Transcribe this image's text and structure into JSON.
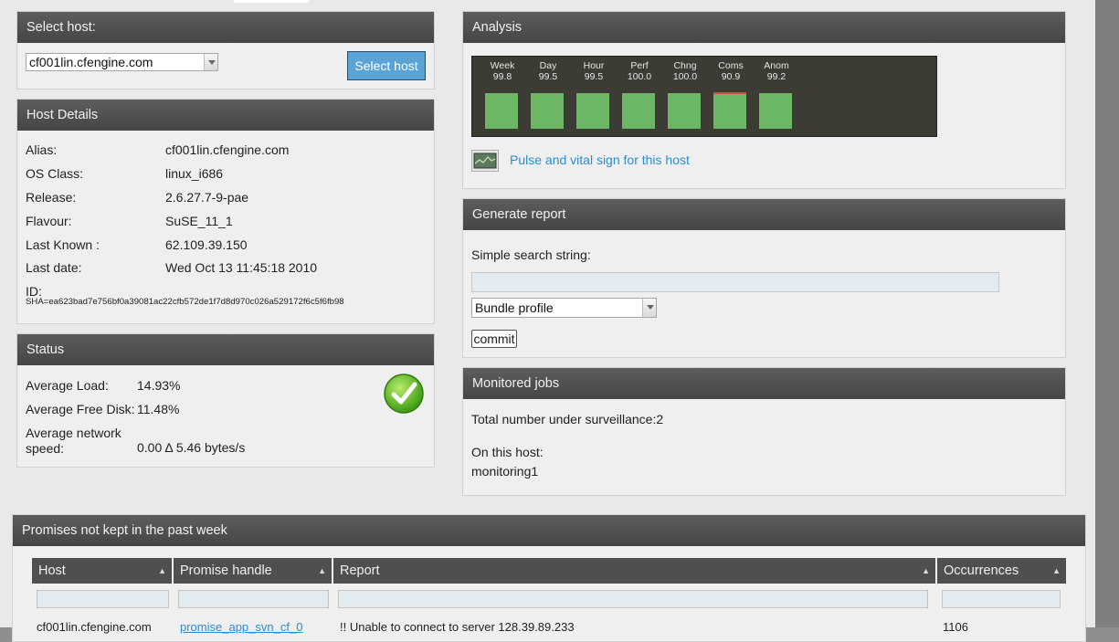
{
  "select_host": {
    "title": "Select host:",
    "selected": "cf001lin.cfengine.com",
    "button": "Select host"
  },
  "host_details": {
    "title": "Host Details",
    "rows": [
      {
        "key": "Alias:",
        "value": "cf001lin.cfengine.com"
      },
      {
        "key": "OS Class:",
        "value": "linux_i686"
      },
      {
        "key": "Release:",
        "value": "2.6.27.7-9-pae"
      },
      {
        "key": "Flavour:",
        "value": "SuSE_11_1"
      },
      {
        "key": "Last Known :",
        "value": "62.109.39.150"
      },
      {
        "key": "Last date:",
        "value": "Wed Oct 13 11:45:18 2010"
      }
    ],
    "id_label": "ID:",
    "id_value": "SHA=ea623bad7e756bf0a39081ac22cfb572de1f7d8d970c026a529172f6c5f6fb98"
  },
  "status": {
    "title": "Status",
    "load_label": "Average Load:",
    "load_value": "14.93%",
    "disk_label": "Average Free Disk:",
    "disk_value": "11.48%",
    "net_label_1": "Average network",
    "net_label_2": "speed:",
    "net_value": "0.00 Δ 5.46 bytes/s",
    "icon": "green-checkmark-icon"
  },
  "analysis": {
    "title": "Analysis",
    "gauges": [
      {
        "label": "Week",
        "value": "99.8",
        "level": 0.998
      },
      {
        "label": "Day",
        "value": "99.5",
        "level": 0.995
      },
      {
        "label": "Hour",
        "value": "99.5",
        "level": 0.995
      },
      {
        "label": "Perf",
        "value": "100.0",
        "level": 1.0
      },
      {
        "label": "Chng",
        "value": "100.0",
        "level": 1.0
      },
      {
        "label": "Coms",
        "value": "90.9",
        "level": 0.909
      },
      {
        "label": "Anom",
        "value": "99.2",
        "level": 0.992
      }
    ],
    "pulse_link": "Pulse and vital sign for this host"
  },
  "report": {
    "title": "Generate report",
    "search_label": "Simple search string:",
    "search_value": "",
    "type_selected": "Bundle profile",
    "commit": "commit"
  },
  "jobs": {
    "title": "Monitored jobs",
    "total": "Total number under surveillance:2",
    "on_host": "On this host:",
    "job": "monitoring1"
  },
  "promises": {
    "title": "Promises not kept in the past week",
    "columns": [
      "Host",
      "Promise handle",
      "Report",
      "Occurrences"
    ],
    "rows": [
      {
        "host": "cf001lin.cfengine.com",
        "handle": "promise_app_svn_cf_0",
        "report": "!! Unable to connect to server 128.39.89.233",
        "occurrences": "1106"
      }
    ]
  },
  "colors": {
    "header_bg": "#4f4f4f",
    "link": "#2b8dd1",
    "gauge_fill": "#6cb765",
    "button": "#5aa3d6"
  }
}
